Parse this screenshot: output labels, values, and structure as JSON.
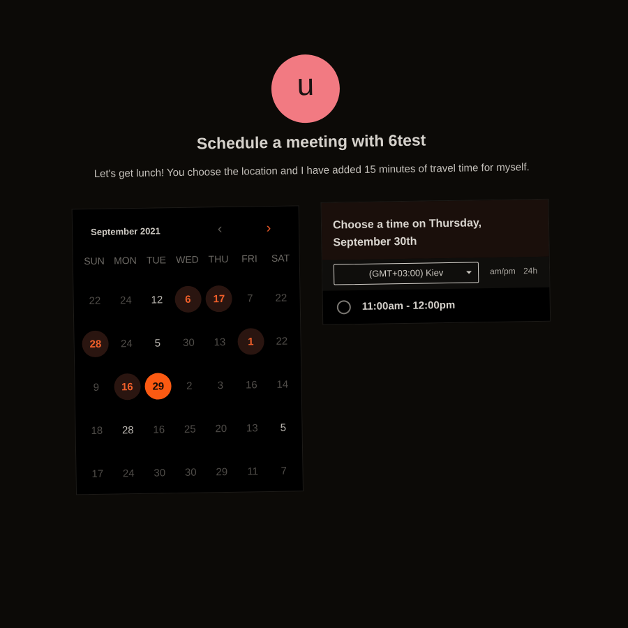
{
  "avatar": {
    "initial": "u",
    "color": "#f27a82"
  },
  "header": {
    "title": "Schedule a meeting with 6test",
    "description": "Let's get lunch! You choose the location and I have added 15 minutes of travel time for myself."
  },
  "calendar": {
    "month_label": "September 2021",
    "prev_icon": "chevron-left-icon",
    "next_icon": "chevron-right-icon",
    "weekdays": [
      "SUN",
      "MON",
      "TUE",
      "WED",
      "THU",
      "FRI",
      "SAT"
    ],
    "weeks": [
      [
        {
          "label": "22",
          "state": "disabled"
        },
        {
          "label": "24",
          "state": "disabled"
        },
        {
          "label": "12",
          "state": "enabled"
        },
        {
          "label": "6",
          "state": "available"
        },
        {
          "label": "17",
          "state": "available"
        },
        {
          "label": "7",
          "state": "disabled"
        },
        {
          "label": "22",
          "state": "disabled"
        }
      ],
      [
        {
          "label": "28",
          "state": "available"
        },
        {
          "label": "24",
          "state": "disabled"
        },
        {
          "label": "5",
          "state": "enabled"
        },
        {
          "label": "30",
          "state": "disabled"
        },
        {
          "label": "13",
          "state": "disabled"
        },
        {
          "label": "1",
          "state": "available"
        },
        {
          "label": "22",
          "state": "disabled"
        }
      ],
      [
        {
          "label": "9",
          "state": "disabled"
        },
        {
          "label": "16",
          "state": "available"
        },
        {
          "label": "29",
          "state": "selected"
        },
        {
          "label": "2",
          "state": "disabled"
        },
        {
          "label": "3",
          "state": "disabled"
        },
        {
          "label": "16",
          "state": "disabled"
        },
        {
          "label": "14",
          "state": "disabled"
        }
      ],
      [
        {
          "label": "18",
          "state": "disabled"
        },
        {
          "label": "28",
          "state": "enabled"
        },
        {
          "label": "16",
          "state": "disabled"
        },
        {
          "label": "25",
          "state": "disabled"
        },
        {
          "label": "20",
          "state": "disabled"
        },
        {
          "label": "13",
          "state": "disabled"
        },
        {
          "label": "5",
          "state": "enabled"
        }
      ],
      [
        {
          "label": "17",
          "state": "disabled"
        },
        {
          "label": "24",
          "state": "disabled"
        },
        {
          "label": "30",
          "state": "disabled"
        },
        {
          "label": "30",
          "state": "disabled"
        },
        {
          "label": "29",
          "state": "disabled"
        },
        {
          "label": "11",
          "state": "disabled"
        },
        {
          "label": "7",
          "state": "disabled"
        }
      ]
    ]
  },
  "time_panel": {
    "heading_line1": "Choose a time on Thursday,",
    "heading_line2": "September 30th",
    "timezone": "(GMT+03:00) Kiev",
    "format_ampm": "am/pm",
    "format_24h": "24h",
    "slots": [
      {
        "label": "11:00am - 12:00pm"
      }
    ]
  },
  "colors": {
    "background": "#0c0a07",
    "accent": "#fb5a12",
    "available_bg": "#2a1510",
    "panel_header_bg": "#1a0f0b"
  }
}
